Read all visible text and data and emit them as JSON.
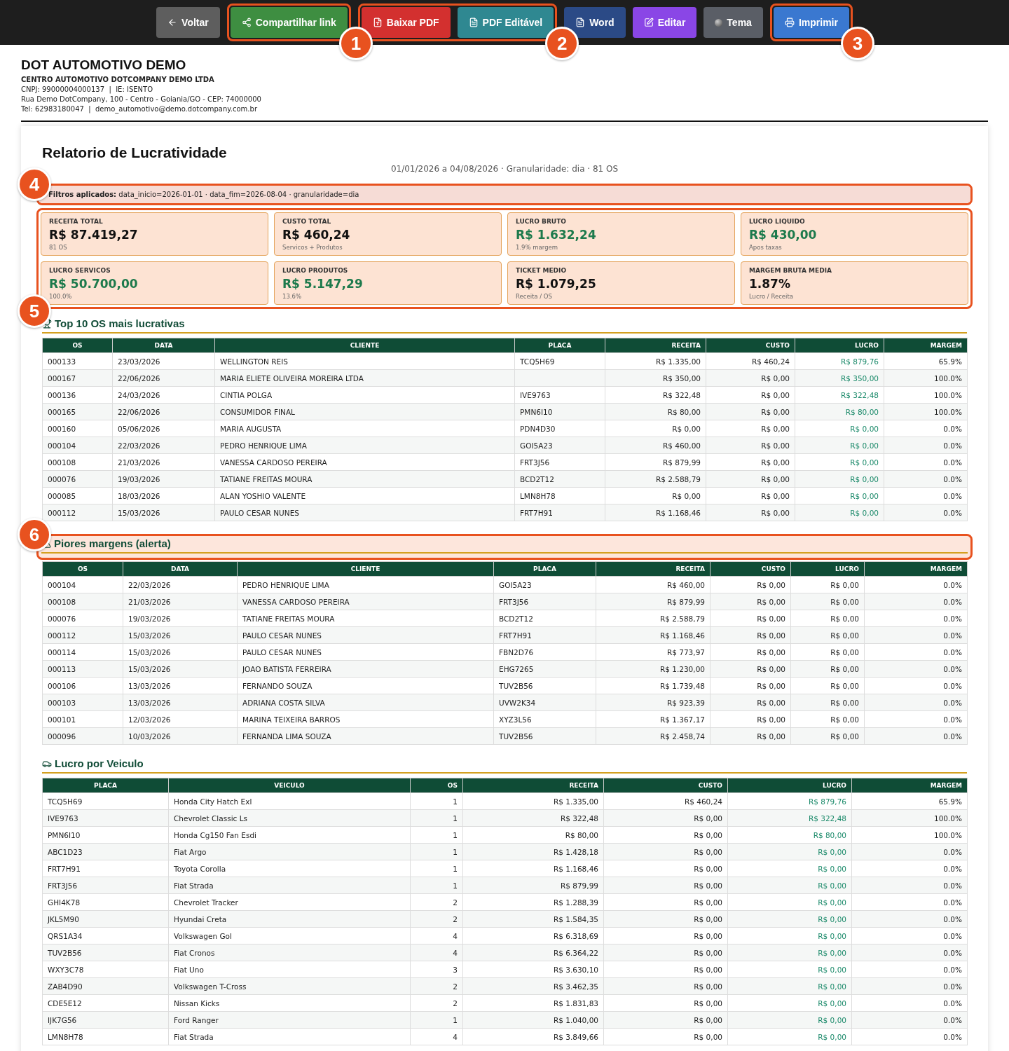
{
  "toolbar": {
    "items": [
      {
        "kind": "button",
        "button": {
          "kind": "back",
          "label": "Voltar"
        }
      },
      {
        "kind": "callout",
        "label": "1",
        "buttons": [
          {
            "kind": "share",
            "label": "Compartilhar link"
          }
        ]
      },
      {
        "kind": "callout",
        "label": "2",
        "buttons": [
          {
            "kind": "pdf",
            "label": "Baixar PDF"
          },
          {
            "kind": "editable",
            "label": "PDF Editável"
          }
        ]
      },
      {
        "kind": "button",
        "button": {
          "kind": "word",
          "label": "Word"
        }
      },
      {
        "kind": "button",
        "button": {
          "kind": "edit",
          "label": "Editar"
        }
      },
      {
        "kind": "button",
        "button": {
          "kind": "theme",
          "label": "Tema"
        }
      },
      {
        "kind": "callout",
        "label": "3",
        "buttons": [
          {
            "kind": "print",
            "label": "Imprimir"
          }
        ]
      }
    ]
  },
  "company": {
    "name": "DOT AUTOMOTIVO DEMO",
    "legal_name": "CENTRO AUTOMOTIVO DOTCOMPANY DEMO LTDA",
    "lines": [
      "CNPJ: 99000004000137  |  IE: ISENTO",
      "Rua Demo DotCompany, 100 - Centro - Goiania/GO - CEP: 74000000",
      "Tel: 62983180047  |  demo_automotivo@demo.dotcompany.com.br"
    ]
  },
  "report": {
    "title": "Relatorio de Lucratividade",
    "subtitle": "01/01/2026 a 04/08/2026 · Granularidade: dia · 81 OS",
    "filters": {
      "callout": "4",
      "text": "**Filtros aplicados:** data_inicio=2026-01-01 · data_fim=2026-08-04 · granularidade=dia"
    },
    "kpis_callout": "5",
    "kpis": [
      {
        "label": "RECEITA TOTAL",
        "value": "R$ 87.419,27",
        "note": "81 OS",
        "positive": false
      },
      {
        "label": "CUSTO TOTAL",
        "value": "R$ 460,24",
        "note": "Servicos + Produtos",
        "positive": false
      },
      {
        "label": "LUCRO BRUTO",
        "value": "R$ 1.632,24",
        "note": "1.9% margem",
        "positive": true
      },
      {
        "label": "LUCRO LIQUIDO",
        "value": "R$ 430,00",
        "note": "Apos taxas",
        "positive": true
      },
      {
        "label": "LUCRO SERVICOS",
        "value": "R$ 50.700,00",
        "note": "100.0%",
        "positive": true
      },
      {
        "label": "LUCRO PRODUTOS",
        "value": "R$ 5.147,29",
        "note": "13.6%",
        "positive": true
      },
      {
        "label": "TICKET MEDIO",
        "value": "R$ 1.079,25",
        "note": "Receita / OS",
        "positive": false
      },
      {
        "label": "MARGEM BRUTA MEDIA",
        "value": "1.87%",
        "note": "Lucro / Receita",
        "positive": false
      }
    ],
    "sections": [
      {
        "kind": "top",
        "title": "Top 10 OS mais lucrativas",
        "profit_colored": true,
        "columns": [
          {
            "label": "OS",
            "numeric": false
          },
          {
            "label": "DATA",
            "numeric": false
          },
          {
            "label": "CLIENTE",
            "numeric": false
          },
          {
            "label": "PLACA",
            "numeric": false
          },
          {
            "label": "RECEITA",
            "numeric": true
          },
          {
            "label": "CUSTO",
            "numeric": true
          },
          {
            "label": "LUCRO",
            "numeric": true
          },
          {
            "label": "MARGEM",
            "numeric": true
          }
        ],
        "rows": [
          [
            "000133",
            "23/03/2026",
            "WELLINGTON REIS",
            "TCQ5H69",
            "R$ 1.335,00",
            "R$ 460,24",
            "R$ 879,76",
            "65.9%"
          ],
          [
            "000167",
            "22/06/2026",
            "MARIA ELIETE OLIVEIRA MOREIRA LTDA",
            null,
            "R$ 350,00",
            "R$ 0,00",
            "R$ 350,00",
            "100.0%"
          ],
          [
            "000136",
            "24/03/2026",
            "CINTIA POLGA",
            "IVE9763",
            "R$ 322,48",
            "R$ 0,00",
            "R$ 322,48",
            "100.0%"
          ],
          [
            "000165",
            "22/06/2026",
            "CONSUMIDOR FINAL",
            "PMN6I10",
            "R$ 80,00",
            "R$ 0,00",
            "R$ 80,00",
            "100.0%"
          ],
          [
            "000160",
            "05/06/2026",
            "MARIA AUGUSTA",
            "PDN4D30",
            "R$ 0,00",
            "R$ 0,00",
            "R$ 0,00",
            "0.0%"
          ],
          [
            "000104",
            "22/03/2026",
            "PEDRO HENRIQUE LIMA",
            "GOI5A23",
            "R$ 460,00",
            "R$ 0,00",
            "R$ 0,00",
            "0.0%"
          ],
          [
            "000108",
            "21/03/2026",
            "VANESSA CARDOSO PEREIRA",
            "FRT3J56",
            "R$ 879,99",
            "R$ 0,00",
            "R$ 0,00",
            "0.0%"
          ],
          [
            "000076",
            "19/03/2026",
            "TATIANE FREITAS MOURA",
            "BCD2T12",
            "R$ 2.588,79",
            "R$ 0,00",
            "R$ 0,00",
            "0.0%"
          ],
          [
            "000085",
            "18/03/2026",
            "ALAN YOSHIO VALENTE",
            "LMN8H78",
            "R$ 0,00",
            "R$ 0,00",
            "R$ 0,00",
            "0.0%"
          ],
          [
            "000112",
            "15/03/2026",
            "PAULO CESAR NUNES",
            "FRT7H91",
            "R$ 1.168,46",
            "R$ 0,00",
            "R$ 0,00",
            "0.0%"
          ]
        ]
      },
      {
        "kind": "alert",
        "title": "Piores margens (alerta)",
        "callout": "6",
        "profit_colored": false,
        "columns": [
          {
            "label": "OS",
            "numeric": false
          },
          {
            "label": "DATA",
            "numeric": false
          },
          {
            "label": "CLIENTE",
            "numeric": false
          },
          {
            "label": "PLACA",
            "numeric": false
          },
          {
            "label": "RECEITA",
            "numeric": true
          },
          {
            "label": "CUSTO",
            "numeric": true
          },
          {
            "label": "LUCRO",
            "numeric": true
          },
          {
            "label": "MARGEM",
            "numeric": true
          }
        ],
        "rows": [
          [
            "000104",
            "22/03/2026",
            "PEDRO HENRIQUE LIMA",
            "GOI5A23",
            "R$ 460,00",
            "R$ 0,00",
            "R$ 0,00",
            "0.0%"
          ],
          [
            "000108",
            "21/03/2026",
            "VANESSA CARDOSO PEREIRA",
            "FRT3J56",
            "R$ 879,99",
            "R$ 0,00",
            "R$ 0,00",
            "0.0%"
          ],
          [
            "000076",
            "19/03/2026",
            "TATIANE FREITAS MOURA",
            "BCD2T12",
            "R$ 2.588,79",
            "R$ 0,00",
            "R$ 0,00",
            "0.0%"
          ],
          [
            "000112",
            "15/03/2026",
            "PAULO CESAR NUNES",
            "FRT7H91",
            "R$ 1.168,46",
            "R$ 0,00",
            "R$ 0,00",
            "0.0%"
          ],
          [
            "000114",
            "15/03/2026",
            "PAULO CESAR NUNES",
            "FBN2D76",
            "R$ 773,97",
            "R$ 0,00",
            "R$ 0,00",
            "0.0%"
          ],
          [
            "000113",
            "15/03/2026",
            "JOAO BATISTA FERREIRA",
            "EHG7265",
            "R$ 1.230,00",
            "R$ 0,00",
            "R$ 0,00",
            "0.0%"
          ],
          [
            "000106",
            "13/03/2026",
            "FERNANDO SOUZA",
            "TUV2B56",
            "R$ 1.739,48",
            "R$ 0,00",
            "R$ 0,00",
            "0.0%"
          ],
          [
            "000103",
            "13/03/2026",
            "ADRIANA COSTA SILVA",
            "UVW2K34",
            "R$ 923,39",
            "R$ 0,00",
            "R$ 0,00",
            "0.0%"
          ],
          [
            "000101",
            "12/03/2026",
            "MARINA TEIXEIRA BARROS",
            "XYZ3L56",
            "R$ 1.367,17",
            "R$ 0,00",
            "R$ 0,00",
            "0.0%"
          ],
          [
            "000096",
            "10/03/2026",
            "FERNANDA LIMA SOUZA",
            "TUV2B56",
            "R$ 2.458,74",
            "R$ 0,00",
            "R$ 0,00",
            "0.0%"
          ]
        ]
      },
      {
        "kind": "vehicle",
        "title": "Lucro por Veiculo",
        "profit_colored": true,
        "columns": [
          {
            "label": "PLACA",
            "numeric": false
          },
          {
            "label": "VEICULO",
            "numeric": false
          },
          {
            "label": "OS",
            "numeric": true
          },
          {
            "label": "RECEITA",
            "numeric": true
          },
          {
            "label": "CUSTO",
            "numeric": true
          },
          {
            "label": "LUCRO",
            "numeric": true
          },
          {
            "label": "MARGEM",
            "numeric": true
          }
        ],
        "rows": [
          [
            "TCQ5H69",
            "Honda City Hatch Exl",
            "1",
            "R$ 1.335,00",
            "R$ 460,24",
            "R$ 879,76",
            "65.9%"
          ],
          [
            "IVE9763",
            "Chevrolet Classic Ls",
            "1",
            "R$ 322,48",
            "R$ 0,00",
            "R$ 322,48",
            "100.0%"
          ],
          [
            "PMN6I10",
            "Honda Cg150 Fan Esdi",
            "1",
            "R$ 80,00",
            "R$ 0,00",
            "R$ 80,00",
            "100.0%"
          ],
          [
            "ABC1D23",
            "Fiat Argo",
            "1",
            "R$ 1.428,18",
            "R$ 0,00",
            "R$ 0,00",
            "0.0%"
          ],
          [
            "FRT7H91",
            "Toyota Corolla",
            "1",
            "R$ 1.168,46",
            "R$ 0,00",
            "R$ 0,00",
            "0.0%"
          ],
          [
            "FRT3J56",
            "Fiat Strada",
            "1",
            "R$ 879,99",
            "R$ 0,00",
            "R$ 0,00",
            "0.0%"
          ],
          [
            "GHI4K78",
            "Chevrolet Tracker",
            "2",
            "R$ 1.288,39",
            "R$ 0,00",
            "R$ 0,00",
            "0.0%"
          ],
          [
            "JKL5M90",
            "Hyundai Creta",
            "2",
            "R$ 1.584,35",
            "R$ 0,00",
            "R$ 0,00",
            "0.0%"
          ],
          [
            "QRS1A34",
            "Volkswagen Gol",
            "4",
            "R$ 6.318,69",
            "R$ 0,00",
            "R$ 0,00",
            "0.0%"
          ],
          [
            "TUV2B56",
            "Fiat Cronos",
            "4",
            "R$ 6.364,22",
            "R$ 0,00",
            "R$ 0,00",
            "0.0%"
          ],
          [
            "WXY3C78",
            "Fiat Uno",
            "3",
            "R$ 3.630,10",
            "R$ 0,00",
            "R$ 0,00",
            "0.0%"
          ],
          [
            "ZAB4D90",
            "Volkswagen T-Cross",
            "2",
            "R$ 3.462,35",
            "R$ 0,00",
            "R$ 0,00",
            "0.0%"
          ],
          [
            "CDE5E12",
            "Nissan Kicks",
            "2",
            "R$ 1.831,83",
            "R$ 0,00",
            "R$ 0,00",
            "0.0%"
          ],
          [
            "IJK7G56",
            "Ford Ranger",
            "1",
            "R$ 1.040,00",
            "R$ 0,00",
            "R$ 0,00",
            "0.0%"
          ],
          [
            "LMN8H78",
            "Fiat Strada",
            "4",
            "R$ 3.849,66",
            "R$ 0,00",
            "R$ 0,00",
            "0.0%"
          ]
        ]
      }
    ]
  }
}
